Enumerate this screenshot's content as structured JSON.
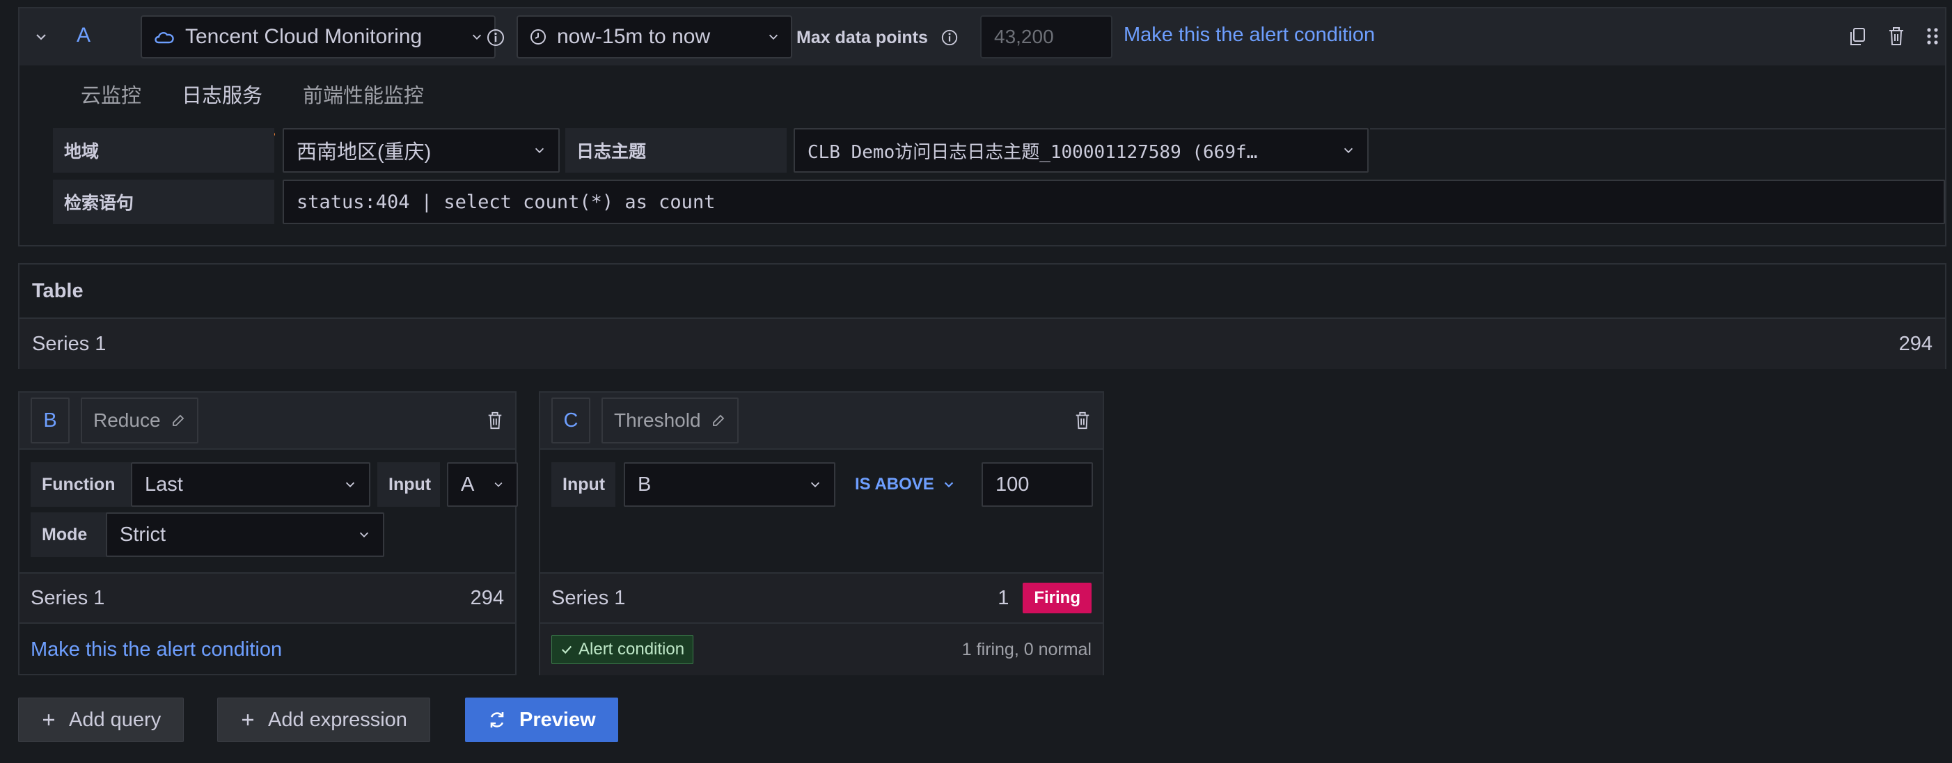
{
  "query": {
    "ref_id": "A",
    "datasource": "Tencent Cloud Monitoring",
    "time_range": "now-15m to now",
    "max_data_points_label": "Max data points",
    "max_data_points_placeholder": "43,200",
    "alert_condition_link": "Make this the alert condition",
    "tabs": [
      {
        "label": "云监控",
        "active": false
      },
      {
        "label": "日志服务",
        "active": true
      },
      {
        "label": "前端性能监控",
        "active": false
      }
    ],
    "fields": {
      "region_label": "地域",
      "region_value": "西南地区(重庆)",
      "topic_label": "日志主题",
      "topic_value": "CLB Demo访问日志日志主题_100001127589 (669f…",
      "query_label": "检索语句",
      "query_value": "status:404 | select count(*) as count"
    }
  },
  "table": {
    "title": "Table",
    "rows": [
      {
        "series": "Series 1",
        "value": "294"
      }
    ]
  },
  "expr_b": {
    "ref_id": "B",
    "name": "Reduce",
    "function_label": "Function",
    "function_value": "Last",
    "input_label": "Input",
    "input_value": "A",
    "mode_label": "Mode",
    "mode_value": "Strict",
    "series": "Series 1",
    "value": "294",
    "alert_condition_link": "Make this the alert condition"
  },
  "expr_c": {
    "ref_id": "C",
    "name": "Threshold",
    "input_label": "Input",
    "input_value": "B",
    "operator": "IS ABOVE",
    "threshold_value": "100",
    "series": "Series 1",
    "value": "1",
    "state": "Firing",
    "alert_condition_badge": "Alert condition",
    "summary": "1 firing, 0 normal"
  },
  "actions": {
    "add_query": "Add query",
    "add_expression": "Add expression",
    "preview": "Preview"
  },
  "colors": {
    "accent": "#6e9fff",
    "primary": "#3d71d9",
    "firing": "#d10e5c",
    "tab_underline": "#f55f3e"
  }
}
